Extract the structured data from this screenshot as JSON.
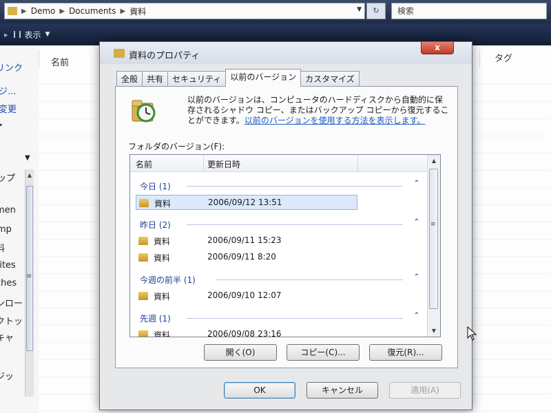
{
  "explorer": {
    "breadcrumb": [
      "Demo",
      "Documents",
      "資料"
    ],
    "search_placeholder": "検索",
    "toolbar_view_label": "表示",
    "nav_items": [
      "リンク",
      "ジ...",
      "変更",
      "ップ",
      "men",
      "mp",
      "料",
      "rites",
      "ches",
      "ンロー",
      "クトッ",
      "キャ",
      "ジッ"
    ],
    "columns": {
      "name": "名前",
      "tag": "タグ"
    }
  },
  "dialog": {
    "title": "資料のプロパティ",
    "close_label": "x",
    "tabs": [
      "全般",
      "共有",
      "セキュリティ",
      "以前のバージョン",
      "カスタマイズ"
    ],
    "active_tab": 3,
    "description": "以前のバージョンは、コンピュータのハードディスクから自動的に保存されるシャドウ コピー、またはバックアップ コピーから復元することができます。",
    "link_text": "以前のバージョンを使用する方法を表示します。",
    "versions_label": "フォルダのバージョン(F):",
    "list_headers": {
      "name": "名前",
      "modified": "更新日時"
    },
    "groups": [
      {
        "label": "今日 (1)",
        "items": [
          {
            "name": "資料",
            "date": "2006/09/12 13:51",
            "selected": true
          }
        ]
      },
      {
        "label": "昨日 (2)",
        "items": [
          {
            "name": "資料",
            "date": "2006/09/11 15:23"
          },
          {
            "name": "資料",
            "date": "2006/09/11 8:20"
          }
        ]
      },
      {
        "label": "今週の前半 (1)",
        "items": [
          {
            "name": "資料",
            "date": "2006/09/10 12:07"
          }
        ]
      },
      {
        "label": "先週 (1)",
        "items": [
          {
            "name": "資料",
            "date": "2006/09/08 23:16"
          }
        ]
      }
    ],
    "panel_buttons": {
      "open": "開く(O)",
      "copy": "コピー(C)...",
      "restore": "復元(R)..."
    },
    "buttons": {
      "ok": "OK",
      "cancel": "キャンセル",
      "apply": "適用(A)"
    }
  }
}
